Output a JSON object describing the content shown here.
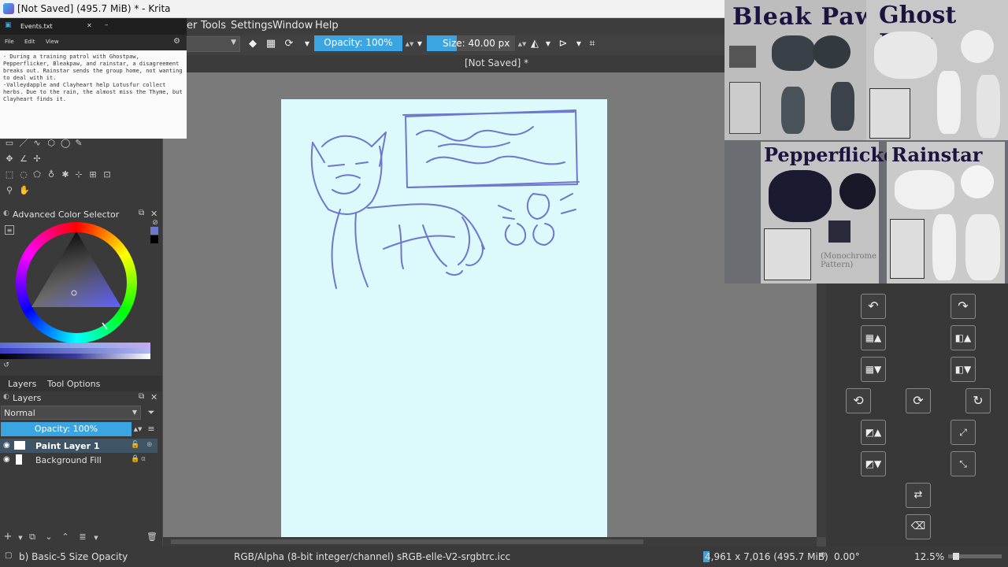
{
  "window": {
    "title": "[Not Saved]  (495.7 MiB)  * - Krita"
  },
  "menu": {
    "items": [
      "er",
      "Tools",
      "Settings",
      "Window",
      "Help"
    ]
  },
  "toolbar": {
    "opacity": "Opacity: 100%",
    "size": "Size: 40.00 px"
  },
  "document": {
    "tab_label": "[Not Saved]  *"
  },
  "notepad": {
    "tab_label": "Events.txt",
    "menu": [
      "File",
      "Edit",
      "View"
    ],
    "content": "- During a training patrol with Ghostpaw, Pepperflicker, Bleakpaw, and rainstar, a disagreement breaks out. Rainstar sends the group home, not wanting to deal with it.\n-Valleydapple and Clayheart help Lotusfur collect herbs. Due to the rain, the almost miss the Thyme, but Clayheart finds it."
  },
  "color_selector": {
    "title": "Advanced Color Selector"
  },
  "layers_panel": {
    "tabs": [
      "Layers",
      "Tool Options"
    ],
    "title": "Layers",
    "blend_mode": "Normal",
    "opacity": "Opacity:  100%",
    "layers": [
      {
        "name": "Paint Layer 1",
        "selected": true
      },
      {
        "name": "Background Fill",
        "selected": false
      }
    ]
  },
  "status": {
    "brush": "b) Basic-5 Size Opacity",
    "color_space": "RGB/Alpha (8-bit integer/channel)  sRGB-elle-V2-srgbtrc.icc",
    "dimensions": "4,961 x 7,016 (495.7 MiB)",
    "rotation": "0.00°",
    "zoom": "12.5%"
  },
  "reference": {
    "names": [
      "Bleak Paw",
      "Ghost Paw",
      "Pepperflicker",
      "Rainstar"
    ],
    "note": "(Monochrome Pattern)"
  },
  "colors": {
    "accent": "#3aa5e0",
    "paper": "#dcf9fc",
    "sketch": "#6d78cc"
  }
}
